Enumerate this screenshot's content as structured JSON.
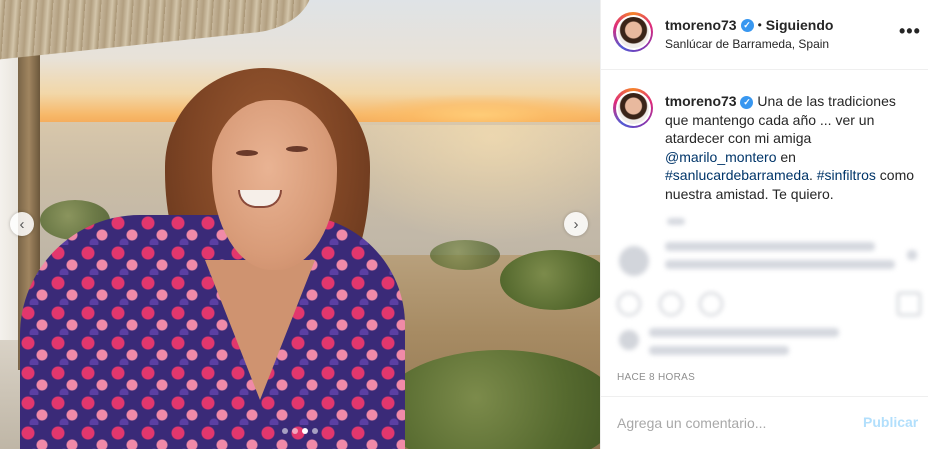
{
  "post": {
    "username": "tmoreno73",
    "verified_glyph": "✓",
    "separator": "•",
    "follow_status": "Siguiendo",
    "location": "Sanlúcar de Barrameda, Spain",
    "more_glyph": "•••",
    "photo_alt": "Woman smiling at sunset by the sea",
    "carousel": {
      "prev_icon": "‹",
      "next_icon": "›",
      "slides": 4,
      "active_index": 2
    }
  },
  "caption": {
    "username": "tmoreno73",
    "text_1": " Una de las tradiciones que mantengo cada año ... ver un atardecer con mi amiga ",
    "mention": "@marilo_montero",
    "text_2": " en ",
    "hashtag_1": "#sanlucardebarrameda",
    "text_3": ". ",
    "hashtag_2": "#sinfiltros",
    "text_4": " como nuestra amistad. Te quiero."
  },
  "timestamp": "Hace 8 horas",
  "comment_box": {
    "placeholder": "Agrega un comentario...",
    "publish_label": "Publicar"
  },
  "colors": {
    "verified": "#3897f0",
    "link": "#003569",
    "publish_disabled": "#b2dffc",
    "muted": "#8e8e8e"
  },
  "icons": {
    "verified": "verified-badge-icon",
    "more": "more-options-icon",
    "prev": "chevron-left-icon",
    "next": "chevron-right-icon"
  }
}
